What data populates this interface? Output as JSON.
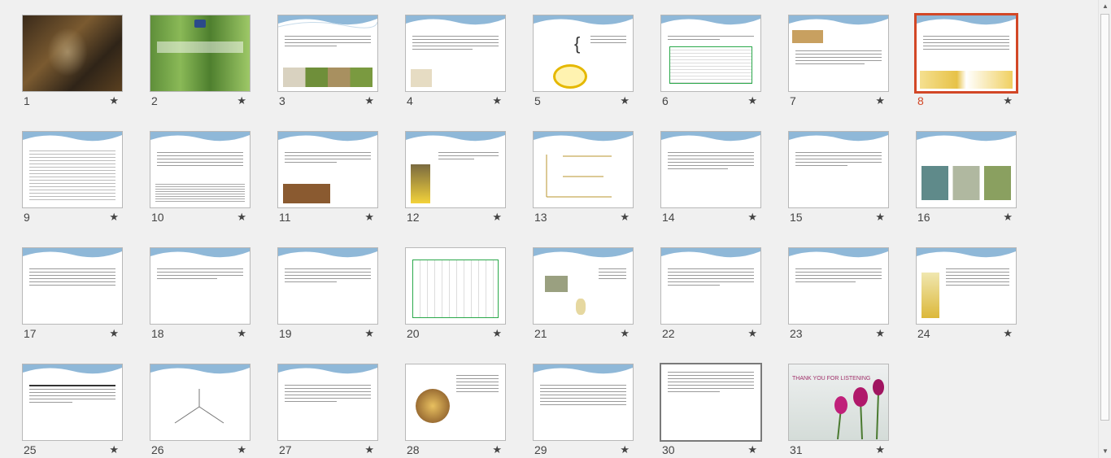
{
  "selected_slide": "8",
  "star_glyph": "★",
  "slides": [
    {
      "num": "1"
    },
    {
      "num": "2"
    },
    {
      "num": "3"
    },
    {
      "num": "4"
    },
    {
      "num": "5"
    },
    {
      "num": "6"
    },
    {
      "num": "7"
    },
    {
      "num": "8"
    },
    {
      "num": "9"
    },
    {
      "num": "10"
    },
    {
      "num": "11"
    },
    {
      "num": "12"
    },
    {
      "num": "13"
    },
    {
      "num": "14"
    },
    {
      "num": "15"
    },
    {
      "num": "16"
    },
    {
      "num": "17"
    },
    {
      "num": "18"
    },
    {
      "num": "19"
    },
    {
      "num": "20"
    },
    {
      "num": "21"
    },
    {
      "num": "22"
    },
    {
      "num": "23"
    },
    {
      "num": "24"
    },
    {
      "num": "25"
    },
    {
      "num": "26"
    },
    {
      "num": "27"
    },
    {
      "num": "28"
    },
    {
      "num": "29"
    },
    {
      "num": "30"
    },
    {
      "num": "31"
    }
  ],
  "slide31_caption": "THANK YOU FOR LISTENING",
  "colors": {
    "selection": "#d24726",
    "title_blue": "#1f6fb2",
    "wave": "#8fb8d8"
  },
  "icons": {
    "scroll_up": "up-arrow-icon",
    "scroll_down": "down-arrow-icon",
    "transition": "star-icon"
  }
}
